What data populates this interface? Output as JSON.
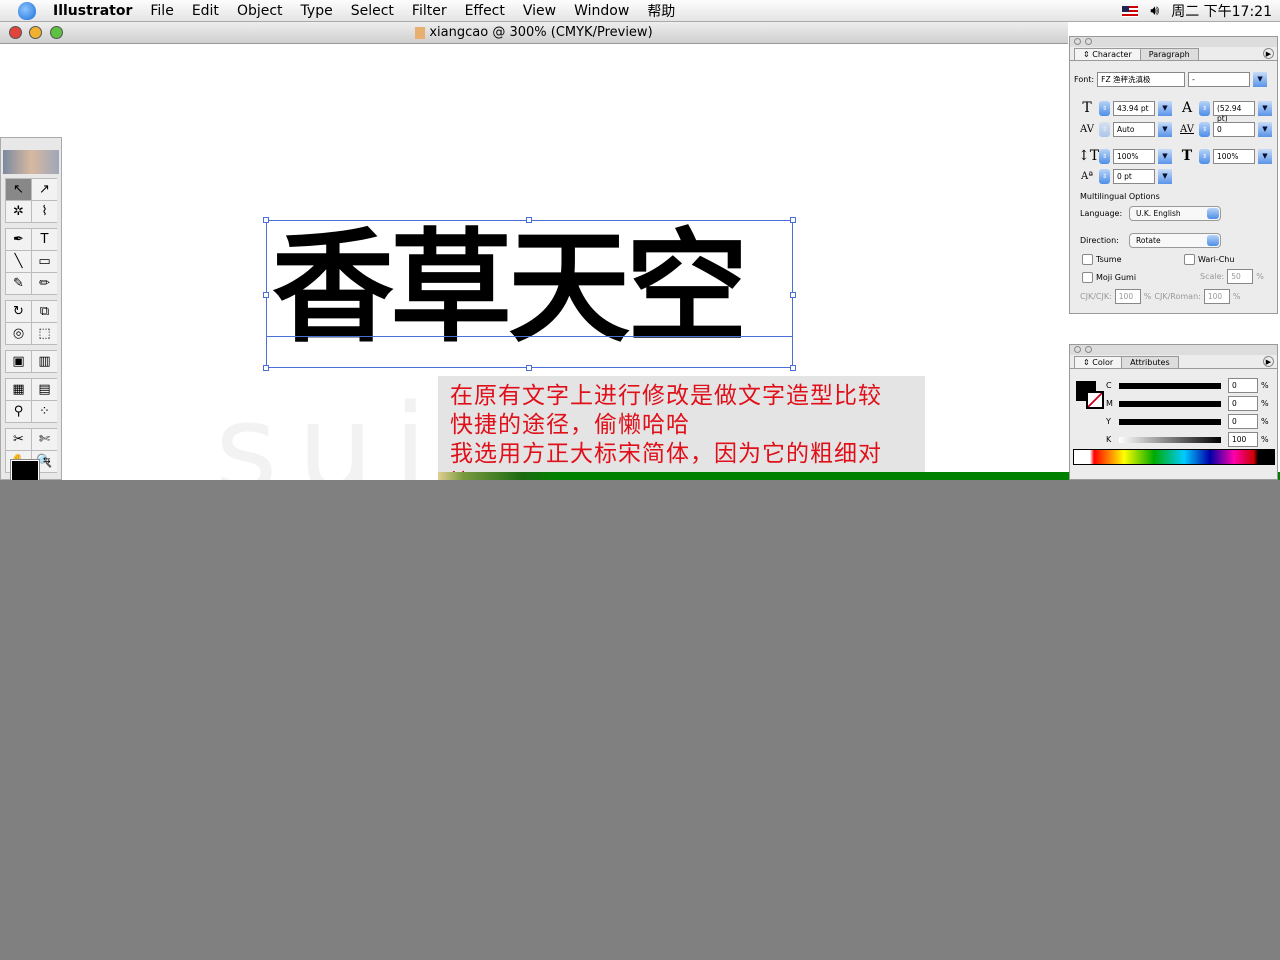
{
  "menubar": {
    "items": [
      "Illustrator",
      "File",
      "Edit",
      "Object",
      "Type",
      "Select",
      "Filter",
      "Effect",
      "View",
      "Window",
      "帮助"
    ],
    "clock": "周二 下午17:21"
  },
  "window": {
    "title": "xiangcao @ 300% (CMYK/Preview)"
  },
  "artboard": {
    "text": "香草天空",
    "watermark": "suiGod"
  },
  "note": {
    "lines": [
      "在原有文字上进行修改是做文字造型比较",
      "快捷的途径，偷懒哈哈",
      "我选用方正大标宋简体，因为它的粗细对",
      "比"
    ]
  },
  "toolbox": {
    "tools": [
      [
        "↖",
        "↗"
      ],
      [
        "✲",
        "⌇"
      ],
      [
        "✒",
        "T"
      ],
      [
        "╲",
        "▭"
      ],
      [
        "✎",
        "✏"
      ],
      [
        "↻",
        "⧉"
      ],
      [
        "◎",
        "⬚"
      ],
      [
        "▣",
        "▥"
      ],
      [
        "▦",
        "▤"
      ],
      [
        "⚲",
        "⁘"
      ],
      [
        "✂",
        "✄"
      ],
      [
        "✋",
        "🔍"
      ]
    ]
  },
  "character_panel": {
    "tabs": [
      "Character",
      "Paragraph"
    ],
    "font_label": "Font:",
    "font": "FZ 渔秤洗滇极",
    "font_style": "-",
    "size": "43.94 pt",
    "leading": "(52.94 pt)",
    "kerning": "Auto",
    "tracking": "0",
    "vscale": "100%",
    "hscale": "100%",
    "baseline": "0 pt",
    "multilingual": "Multilingual Options",
    "language_label": "Language:",
    "language": "U.K. English",
    "direction_label": "Direction:",
    "direction": "Rotate",
    "tsume": "Tsume",
    "warichu": "Wari-Chu",
    "mojigumi": "Moji Gumi",
    "scale_label": "Scale:",
    "scale": "50",
    "pct": "%",
    "cjkcjk_label": "CJK/CJK:",
    "cjkcjk": "100",
    "cjkroman_label": "CJK/Roman:",
    "cjkroman": "100"
  },
  "color_panel": {
    "tabs": [
      "Color",
      "Attributes"
    ],
    "channels": [
      {
        "label": "C",
        "value": "0"
      },
      {
        "label": "M",
        "value": "0"
      },
      {
        "label": "Y",
        "value": "0"
      },
      {
        "label": "K",
        "value": "100"
      }
    ],
    "pct": "%",
    "fill": "#000000"
  },
  "colors": {
    "note_text": "#e0101a",
    "selection": "#4a6fd8",
    "desktop": "#808080"
  }
}
